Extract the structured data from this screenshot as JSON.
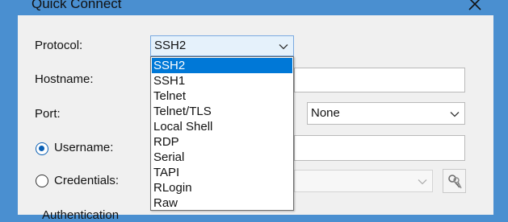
{
  "dialog": {
    "title": "Quick Connect"
  },
  "labels": {
    "protocol": "Protocol:",
    "hostname": "Hostname:",
    "port": "Port:",
    "username": "Username:",
    "credentials": "Credentials:",
    "authentication": "Authentication"
  },
  "protocol_select": {
    "value": "SSH2"
  },
  "firewall_select": {
    "value": "None"
  },
  "protocol_options": [
    "SSH2",
    "SSH1",
    "Telnet",
    "Telnet/TLS",
    "Local Shell",
    "RDP",
    "Serial",
    "TAPI",
    "RLogin",
    "Raw"
  ],
  "selected_option_index": 0,
  "colors": {
    "accent": "#0078d7",
    "titlebar": "#4a8fd0",
    "dialog_bg": "#f0f0f0"
  },
  "icons": {
    "close": "close-icon",
    "chevron": "chevron-down-icon",
    "keys": "keys-icon"
  }
}
